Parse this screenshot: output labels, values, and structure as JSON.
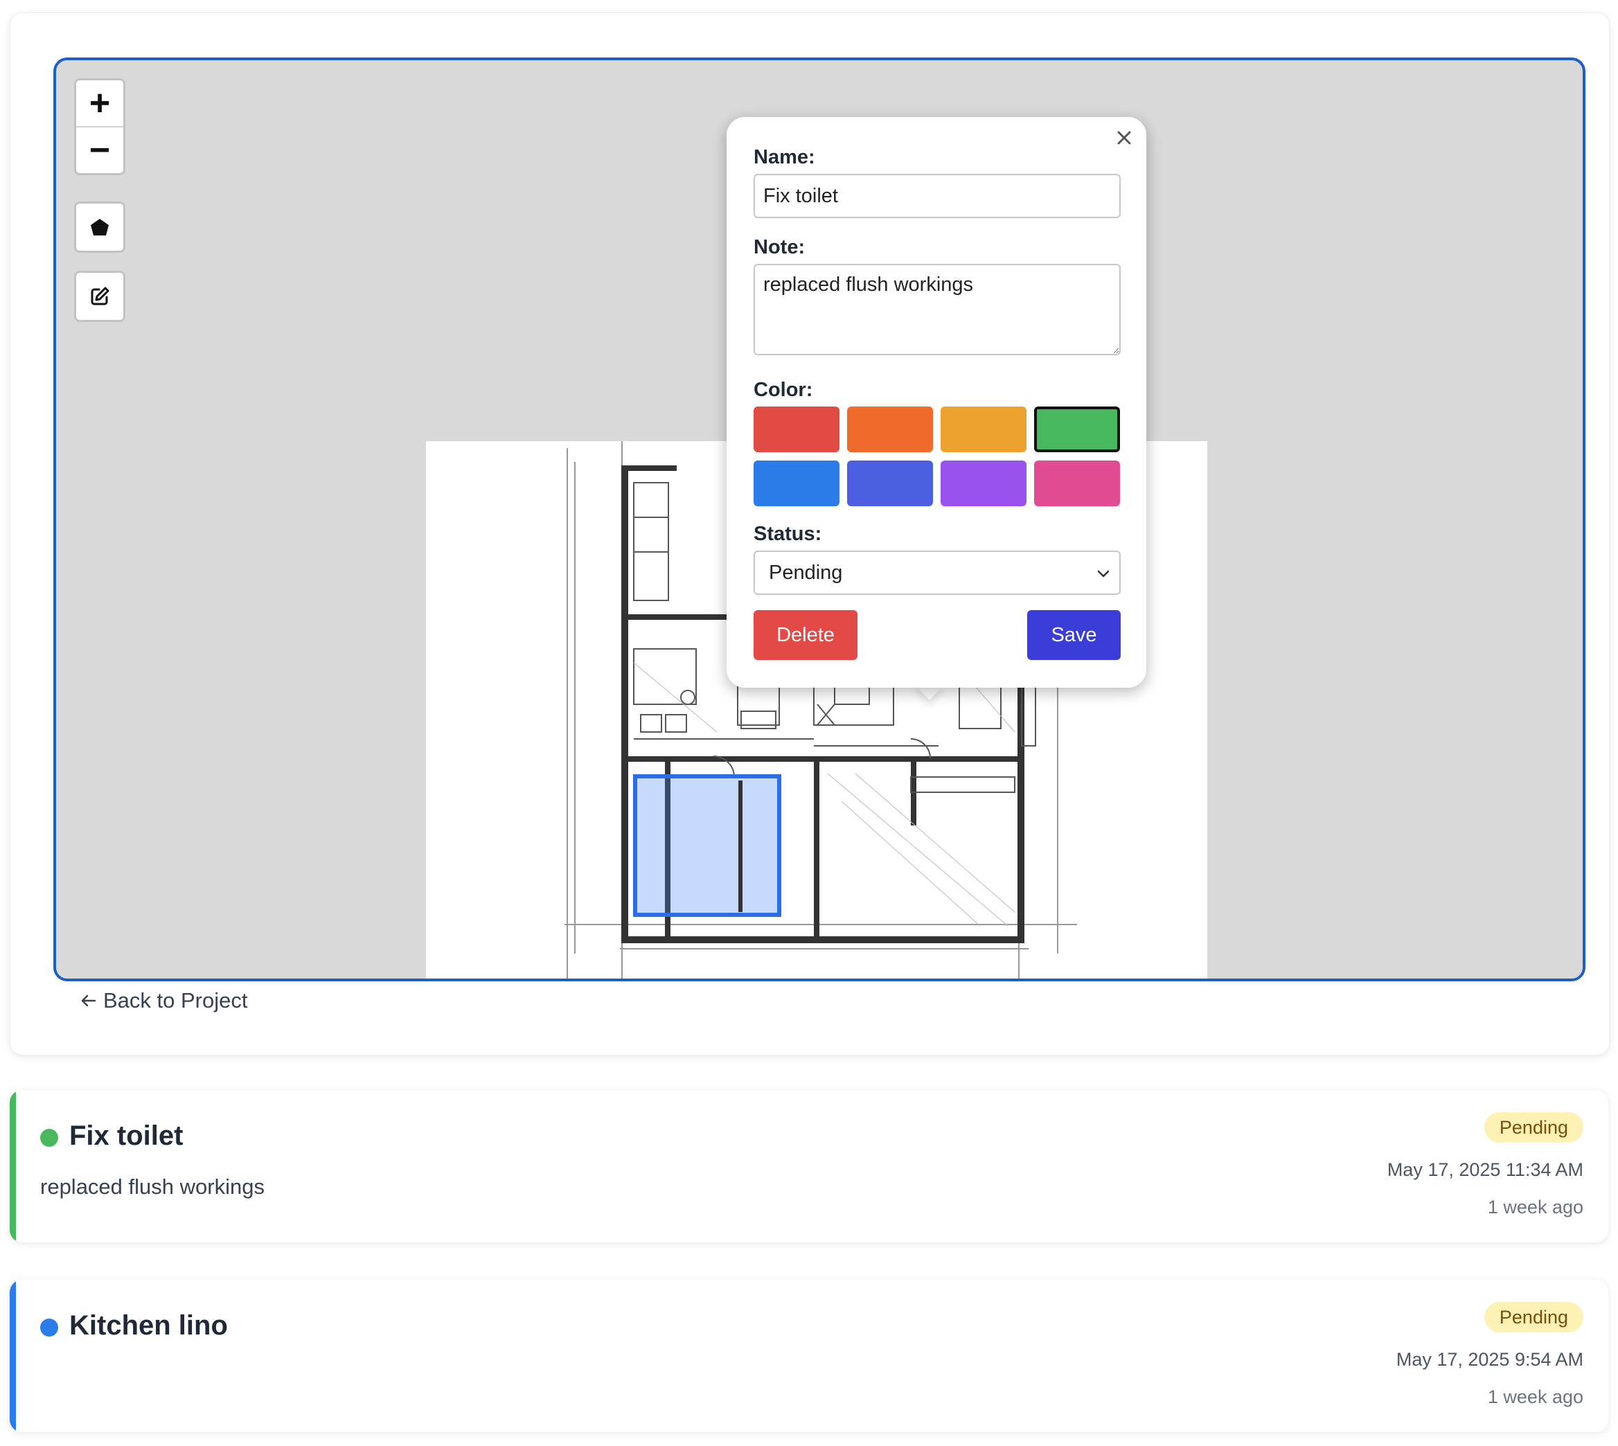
{
  "map": {
    "zoom_in": "+",
    "zoom_out": "−",
    "polygon_tool_icon": "polygon-icon",
    "edit_tool_icon": "edit-icon"
  },
  "popup": {
    "name_label": "Name:",
    "name_value": "Fix toilet",
    "note_label": "Note:",
    "note_value": "replaced flush workings",
    "color_label": "Color:",
    "colors": [
      "#e24a44",
      "#ef6b2c",
      "#eda230",
      "#47b85e",
      "#2b7be8",
      "#4c5fe0",
      "#9a52ef",
      "#e04b92"
    ],
    "selected_color": "#47b85e",
    "status_label": "Status:",
    "status_value": "Pending",
    "delete_label": "Delete",
    "save_label": "Save",
    "delete_color": "#e34a46",
    "save_color": "#3a3dd8"
  },
  "back_link": {
    "label": "Back to Project"
  },
  "issues": [
    {
      "title": "Fix toilet",
      "note": "replaced flush workings",
      "status": "Pending",
      "date": "May 17, 2025 11:34 AM",
      "ago": "1 week ago",
      "color": "#47b85e"
    },
    {
      "title": "Kitchen lino",
      "note": "",
      "status": "Pending",
      "date": "May 17, 2025 9:54 AM",
      "ago": "1 week ago",
      "color": "#2b7be8"
    }
  ]
}
